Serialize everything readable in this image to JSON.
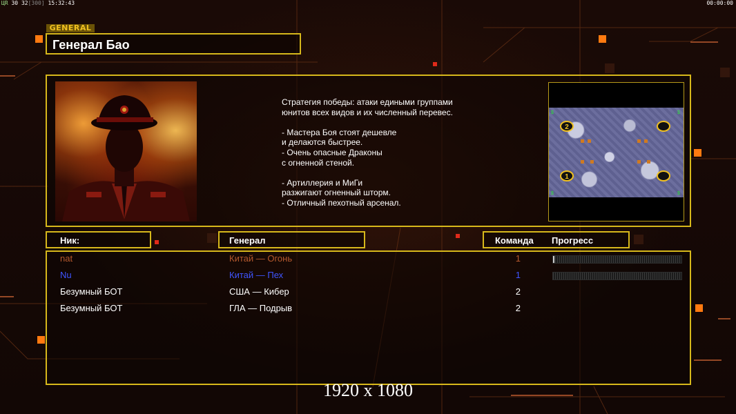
{
  "hud": {
    "fps_label": "ЦR",
    "fps_value": "30",
    "fps_target": "32",
    "fps_limit": "[300]",
    "clock": "15:32:43",
    "timer": "00:00:00"
  },
  "general_tag": "GENERAL",
  "general_name": "Генерал Бао",
  "description": "Стратегия победы: атаки едиными группами\nюнитов всех видов и их численный перевес.\n\n- Мастера Боя стоят дешевле\nи делаются быстрее.\n- Очень опасные Драконы\nс огненной стеной.\n\n- Артиллерия и МиГи\nразжигают огненный шторм.\n- Отличный пехотный арсенал.",
  "columns": {
    "nick": "Ник:",
    "general": "Генерал",
    "team": "Команда",
    "progress": "Прогресс"
  },
  "players": [
    {
      "nick": "nat",
      "general": "Китай — Огонь",
      "team": "1",
      "color": "#b5582d",
      "progress": 0.01,
      "show_progress": true
    },
    {
      "nick": "Nu",
      "general": "Китай — Пех",
      "team": "1",
      "color": "#3f55ff",
      "progress": 0.0,
      "show_progress": true
    },
    {
      "nick": "Безумный БОТ",
      "general": "США — Кибер",
      "team": "2",
      "color": "#ffffff",
      "progress": 0.0,
      "show_progress": false
    },
    {
      "nick": "Безумный БОТ",
      "general": "ГЛА — Подрыв",
      "team": "2",
      "color": "#ffffff",
      "progress": 0.0,
      "show_progress": false
    }
  ],
  "minimap": {
    "start_1": "1",
    "start_2": "2",
    "supply_marker": "$"
  },
  "resolution": "1920 x 1080",
  "colors": {
    "frame": "#d7b81b",
    "accent_square": "#ff7a10"
  }
}
